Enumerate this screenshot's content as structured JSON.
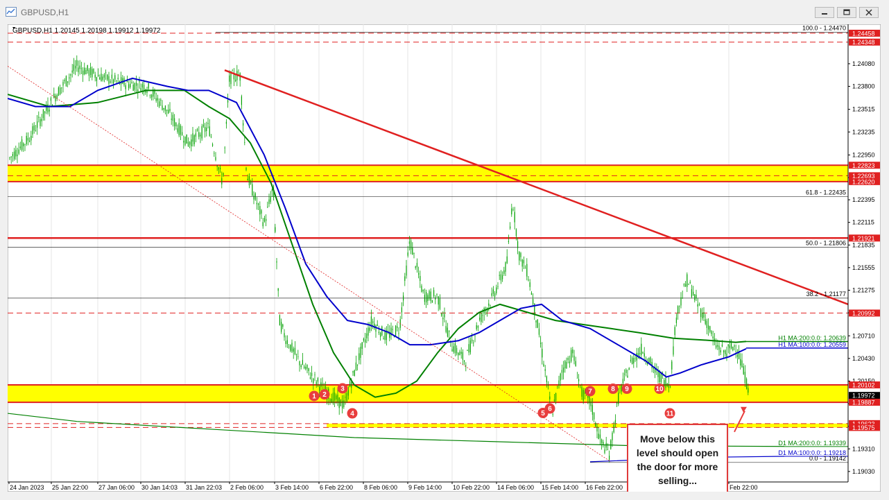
{
  "window": {
    "title": "GBPUSD,H1",
    "buttons": [
      "minimize",
      "restore",
      "close"
    ]
  },
  "chart_header": "GBPUSD,H1  1.20145 1.20198 1.19912 1.19972",
  "annotation": "Move below this level should open the door for more selling...",
  "markers": [
    "1",
    "2",
    "3",
    "4",
    "5",
    "6",
    "7",
    "8",
    "9",
    "10",
    "11"
  ],
  "colors": {
    "support_zone": "#ffff00",
    "resistance_line": "#e02020",
    "ma100_h1": "#0000cc",
    "ma200_h1": "#008000",
    "marker": "#e83d3d",
    "candle": "#00a000"
  },
  "chart_data": {
    "type": "candlestick",
    "symbol": "GBPUSD",
    "timeframe": "H1",
    "ohlc": {
      "open": 1.20145,
      "high": 1.20198,
      "low": 1.19912,
      "close": 1.19972
    },
    "ylim": [
      1.189,
      1.245
    ],
    "y_ticks": [
      "1.24080",
      "1.23800",
      "1.23515",
      "1.23235",
      "1.22950",
      "1.22670",
      "1.22395",
      "1.22115",
      "1.21835",
      "1.21555",
      "1.21275",
      "1.20995",
      "1.20710",
      "1.20430",
      "1.20150",
      "1.19870",
      "1.19590",
      "1.19310",
      "1.19030"
    ],
    "x_ticks": [
      "24 Jan 2023",
      "25 Jan 22:00",
      "27 Jan 06:00",
      "30 Jan 14:03",
      "31 Jan 22:03",
      "2 Feb 06:00",
      "3 Feb 14:00",
      "6 Feb 22:00",
      "8 Feb 06:00",
      "9 Feb 14:00",
      "10 Feb 22:00",
      "14 Feb 06:00",
      "15 Feb 14:00",
      "16 Feb 22:00",
      "Feb 22:00"
    ],
    "price_labels": [
      {
        "text": "1.24458",
        "value": 1.24458,
        "color": "#e02020"
      },
      {
        "text": "1.24348",
        "value": 1.24348,
        "color": "#e02020"
      },
      {
        "text": "1.22823",
        "value": 1.22823,
        "color": "#e02020"
      },
      {
        "text": "1.22693",
        "value": 1.22693,
        "color": "#e02020"
      },
      {
        "text": "1.22620",
        "value": 1.2262,
        "color": "#e02020"
      },
      {
        "text": "1.21921",
        "value": 1.21921,
        "color": "#e02020"
      },
      {
        "text": "1.20992",
        "value": 1.20992,
        "color": "#e02020"
      },
      {
        "text": "1.20102",
        "value": 1.20102,
        "color": "#e02020"
      },
      {
        "text": "1.19972",
        "value": 1.19972,
        "color": "#000000"
      },
      {
        "text": "1.19887",
        "value": 1.19887,
        "color": "#e02020"
      },
      {
        "text": "1.19623",
        "value": 1.19623,
        "color": "#e02020"
      },
      {
        "text": "1.19575",
        "value": 1.19575,
        "color": "#e02020"
      }
    ],
    "fibonacci": [
      {
        "label": "100.0 - 1.24470",
        "value": 1.2447
      },
      {
        "label": "61.8 - 1.22435",
        "value": 1.22435
      },
      {
        "label": "50.0 - 1.21806",
        "value": 1.21806
      },
      {
        "label": "38.2 - 1.21177",
        "value": 1.21177
      },
      {
        "label": "0.0 - 1.19142",
        "value": 1.19142
      }
    ],
    "moving_averages": [
      {
        "label": "H1 MA:200:0.0: 1.20639",
        "value": 1.20639,
        "color": "#008000"
      },
      {
        "label": "H1 MA:100:0.0: 1.20559",
        "value": 1.20559,
        "color": "#0000cc"
      },
      {
        "label": "D1 MA:200:0.0: 1.19339",
        "value": 1.19339,
        "color": "#008000"
      },
      {
        "label": "D1 MA:100:0.0: 1.19218",
        "value": 1.19218,
        "color": "#0000cc"
      }
    ],
    "support_zones": [
      {
        "from": 1.2262,
        "to": 1.22823
      },
      {
        "from": 1.19887,
        "to": 1.20102
      },
      {
        "from": 1.19575,
        "to": 1.19623
      }
    ],
    "trendline": {
      "start": {
        "x": "1 Feb 22:00",
        "y": 1.24
      },
      "end": {
        "x": "20 Feb 22:00",
        "y": 1.211
      }
    }
  }
}
